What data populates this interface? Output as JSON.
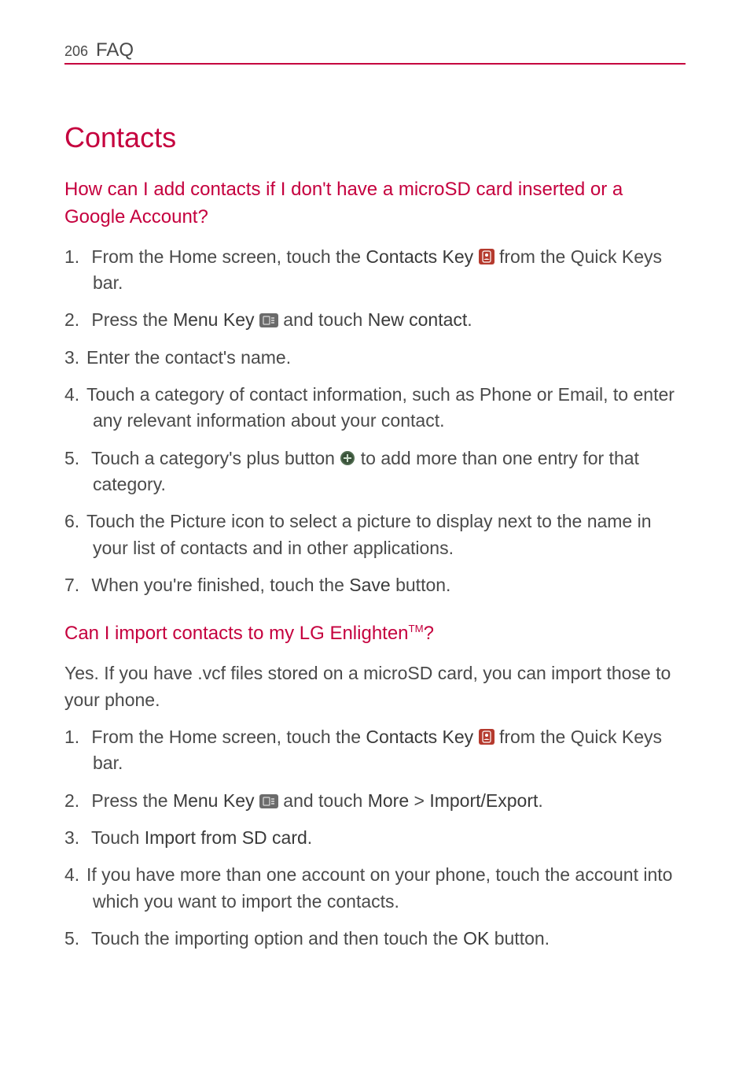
{
  "header": {
    "page_number": "206",
    "section": "FAQ"
  },
  "title": "Contacts",
  "q1": {
    "question": "How can I add contacts if I don't have a microSD card inserted or a Google Account?",
    "s1a": "From the Home screen, touch the ",
    "s1b": "Contacts Key",
    "s1c": " from the Quick Keys bar.",
    "s2a": "Press the ",
    "s2b": "Menu Key",
    "s2c": " and touch ",
    "s2d": "New contact",
    "s2e": ".",
    "s3": "Enter the contact's name.",
    "s4": "Touch a category of contact information, such as Phone or Email, to enter any relevant information about your contact.",
    "s5a": "Touch a category's plus button ",
    "s5b": " to add more than one entry for that category.",
    "s6": "Touch the Picture icon to select a picture to display next to the name in your list of contacts and in other applications.",
    "s7a": "When you're finished, touch the ",
    "s7b": "Save",
    "s7c": " button."
  },
  "q2": {
    "question_a": "Can I import contacts to my LG Enlighten",
    "question_b": "?",
    "tm": "TM",
    "intro": "Yes. If you have .vcf files stored on a microSD card, you can import those to your phone.",
    "s1a": "From the Home screen, touch the ",
    "s1b": "Contacts Key",
    "s1c": " from the Quick Keys bar.",
    "s2a": "Press the ",
    "s2b": "Menu Key",
    "s2c": " and touch ",
    "s2d": "More",
    "s2e": " > ",
    "s2f": "Import/Export",
    "s2g": ".",
    "s3a": "Touch ",
    "s3b": "Import from SD card",
    "s3c": ".",
    "s4": "If you have more than one account on your phone, touch the account into which you want to import the contacts.",
    "s5a": "Touch the importing option and then touch the ",
    "s5b": "OK",
    "s5c": " button."
  }
}
